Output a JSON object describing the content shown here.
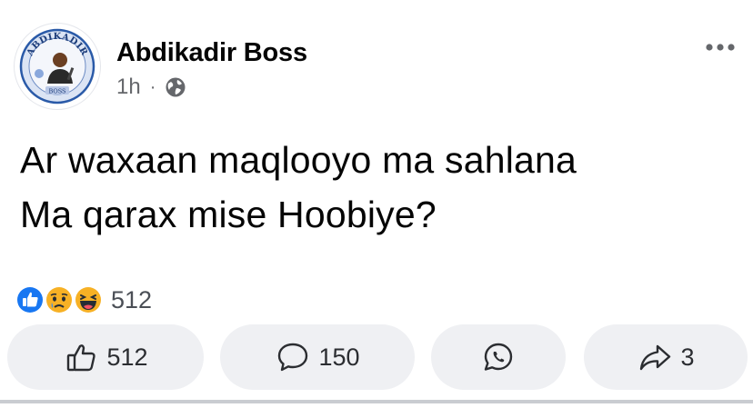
{
  "post": {
    "author": "Abdikadir Boss",
    "avatar_text_top": "ABDIKADIR",
    "avatar_text_bottom": "BOSS",
    "time": "1h",
    "separator": "·",
    "privacy_icon": "globe-icon",
    "text_lines": [
      "Ar waxaan maqlooyo ma sahlana",
      "Ma qarax mise Hoobiye?"
    ]
  },
  "reactions": {
    "icons": [
      "like-reaction-icon",
      "sad-reaction-icon",
      "haha-reaction-icon"
    ],
    "count": "512"
  },
  "actions": {
    "like_count": "512",
    "comment_count": "150",
    "share_count": "3"
  },
  "colors": {
    "like_blue": "#1877f2",
    "reaction_yellow": "#f7b125",
    "button_bg": "#eff0f3",
    "meta_gray": "#65676b"
  }
}
